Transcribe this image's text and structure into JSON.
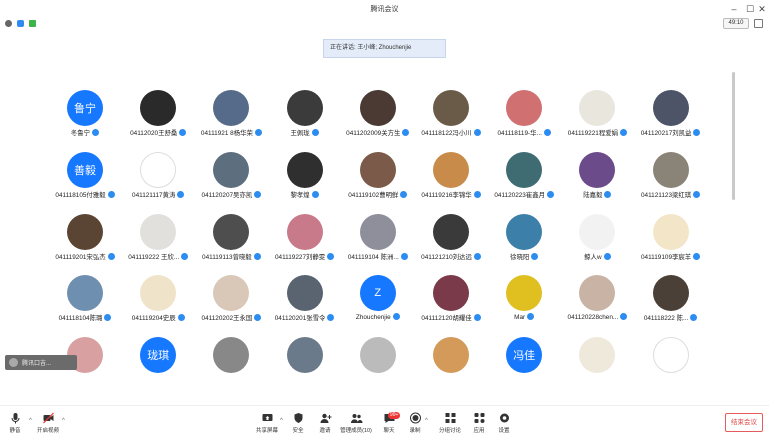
{
  "window": {
    "title": "腾讯会议"
  },
  "statusbar": {
    "timer": "49:10"
  },
  "speaking": {
    "text": "正在讲话: 王小峰; Zhouchenjie"
  },
  "minicard": {
    "label": "腾讯口吉..."
  },
  "toolbar": {
    "mute_label": "静音",
    "video_label": "开启视频",
    "share_label": "共享屏幕",
    "security_label": "安全",
    "invite_label": "邀请",
    "members_label": "管理成员(10)",
    "chat_label": "聊天",
    "chat_badge": "99+",
    "record_label": "录制",
    "layout_label": "分组讨论",
    "apps_label": "应用",
    "settings_label": "设置",
    "end_label": "结束会议"
  },
  "participants": [
    {
      "name": "冬鲁宁",
      "initials": "鲁宁",
      "color": "#1677ff"
    },
    {
      "name": "04112020王舒桑",
      "color": "#2a2a2a"
    },
    {
      "name": "04111921 8杨华荣",
      "color": "#566b8a"
    },
    {
      "name": "王佩珑",
      "color": "#3b3b3b"
    },
    {
      "name": "0411202009关方生",
      "color": "#4a3a33"
    },
    {
      "name": "041118122冯小川",
      "color": "#6a5a48"
    },
    {
      "name": "041118119-华...",
      "color": "#d07070"
    },
    {
      "name": "041119221程爱娟",
      "color": "#e9e6de"
    },
    {
      "name": "041120217刘凯益",
      "color": "#4d5468"
    },
    {
      "name": "041118105付雅毅",
      "initials": "善毅",
      "color": "#1677ff"
    },
    {
      "name": "041121117黄涛",
      "color": "#ffffff"
    },
    {
      "name": "041120207吴亦凯",
      "color": "#5d6e7f"
    },
    {
      "name": "黎孝煌",
      "color": "#2f2f2f"
    },
    {
      "name": "041119102曹明鲜",
      "color": "#7b5a4a"
    },
    {
      "name": "041119216李锦华",
      "color": "#c98b4a"
    },
    {
      "name": "041120223崔鑫月",
      "color": "#3f6b73"
    },
    {
      "name": "陆嘉毅",
      "color": "#6b4b8a"
    },
    {
      "name": "041121123梁红琪",
      "color": "#8a8478"
    },
    {
      "name": "041119201宋弘杰",
      "color": "#5a4535"
    },
    {
      "name": "041119222 王欣...",
      "color": "#e2e0dc"
    },
    {
      "name": "041119113曾晓毅",
      "color": "#4e4e4e"
    },
    {
      "name": "041119227刘静雯",
      "color": "#c97a8a"
    },
    {
      "name": "041119104 陈洲...",
      "color": "#8f8f9b"
    },
    {
      "name": "041121210刘达远",
      "color": "#3a3a3a"
    },
    {
      "name": "徐晓阳",
      "color": "#3c7fa8"
    },
    {
      "name": "鲸人w",
      "color": "#f2f2f2"
    },
    {
      "name": "041119109李宸羊",
      "color": "#f3e6c8"
    },
    {
      "name": "041118104陈璐",
      "color": "#6f8fb0"
    },
    {
      "name": "041119204史辰",
      "color": "#efe3c9"
    },
    {
      "name": "041120202王永国",
      "color": "#d9c7b7"
    },
    {
      "name": "041120201张雪令",
      "color": "#5a6470"
    },
    {
      "name": "Zhouchenjie",
      "initials": "Z",
      "color": "#1677ff"
    },
    {
      "name": "041112120胡耀佳",
      "color": "#7a3a4a"
    },
    {
      "name": "Mar",
      "color": "#e0c020"
    },
    {
      "name": "041120228chen...",
      "color": "#c9b3a5"
    },
    {
      "name": "041118222 陈...",
      "color": "#4a4038"
    },
    {
      "name": "",
      "color": "#d8a0a0"
    },
    {
      "name": "",
      "initials": "珑琪",
      "color": "#1677ff"
    },
    {
      "name": "",
      "color": "#888"
    },
    {
      "name": "",
      "color": "#6a7a8a"
    },
    {
      "name": "",
      "color": "#bbb"
    },
    {
      "name": "",
      "color": "#d49a5a"
    },
    {
      "name": "",
      "initials": "冯佳",
      "color": "#1677ff"
    },
    {
      "name": "",
      "color": "#efe9dc"
    },
    {
      "name": "",
      "color": "#fff"
    }
  ]
}
